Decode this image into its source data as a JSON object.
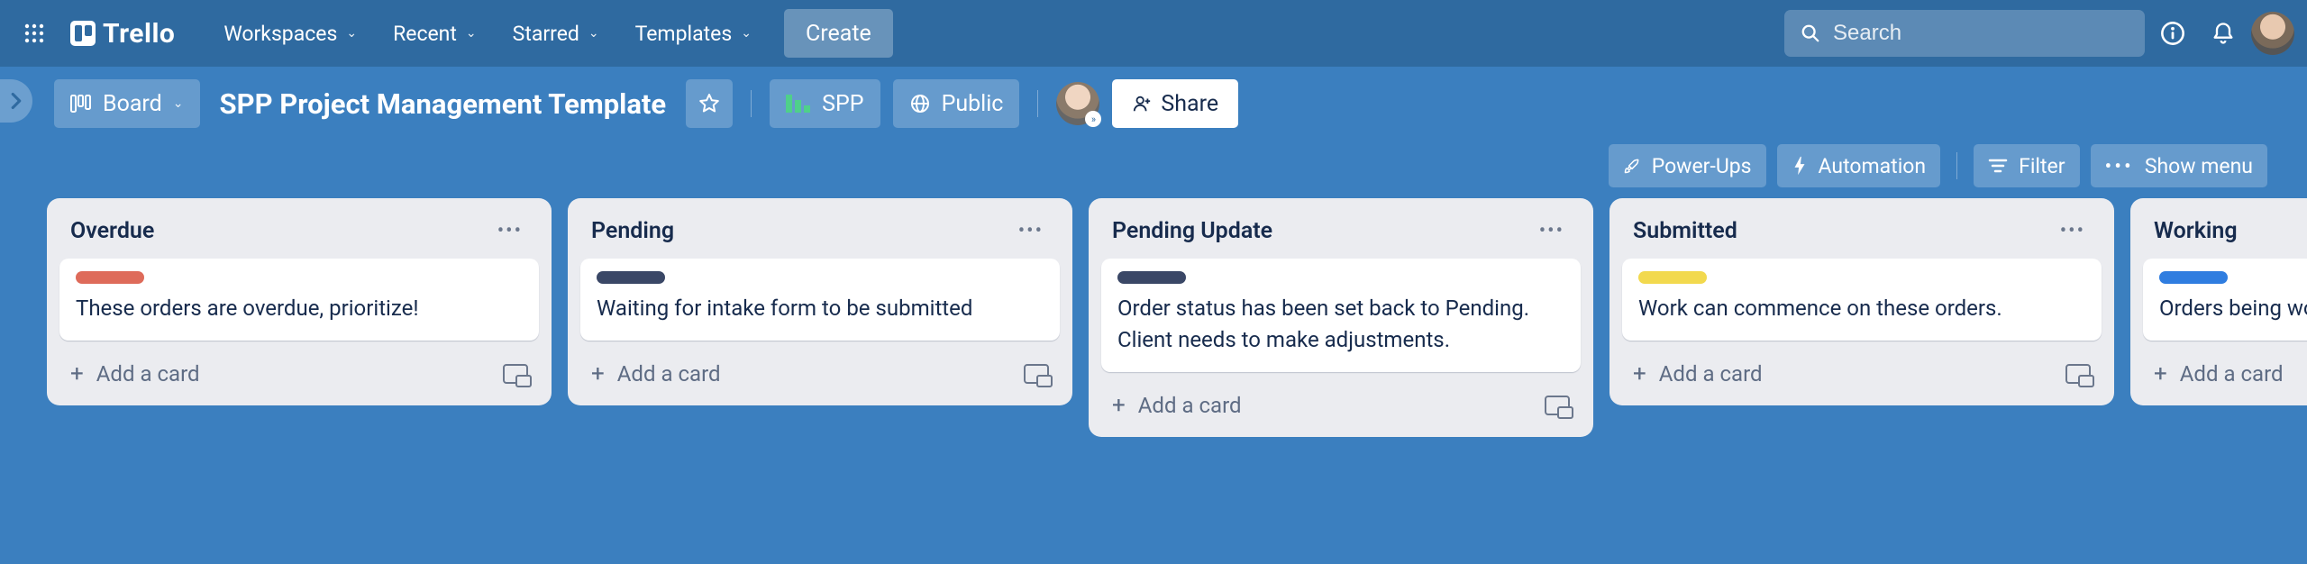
{
  "topnav": {
    "logo_text": "Trello",
    "menus": [
      "Workspaces",
      "Recent",
      "Starred",
      "Templates"
    ],
    "create_label": "Create",
    "search_placeholder": "Search"
  },
  "board_header": {
    "view_label": "Board",
    "title": "SPP Project Management Template",
    "workspace_label": "SPP",
    "visibility_label": "Public",
    "share_label": "Share",
    "powerups_label": "Power-Ups",
    "automation_label": "Automation",
    "filter_label": "Filter",
    "showmenu_label": "Show menu"
  },
  "lists": [
    {
      "title": "Overdue",
      "cards": [
        {
          "label_color": "lbl-red",
          "text": "These orders are overdue, prioritize!"
        }
      ],
      "add_label": "Add a card"
    },
    {
      "title": "Pending",
      "cards": [
        {
          "label_color": "lbl-navy",
          "text": "Waiting for intake form to be submitted"
        }
      ],
      "add_label": "Add a card"
    },
    {
      "title": "Pending Update",
      "cards": [
        {
          "label_color": "lbl-navy",
          "text": "Order status has been set back to Pending. Client needs to make adjustments."
        }
      ],
      "add_label": "Add a card"
    },
    {
      "title": "Submitted",
      "cards": [
        {
          "label_color": "lbl-yellow",
          "text": "Work can commence on these orders."
        }
      ],
      "add_label": "Add a card"
    },
    {
      "title": "Working",
      "cards": [
        {
          "label_color": "lbl-blue",
          "text": "Orders being worked on."
        }
      ],
      "add_label": "Add a card"
    }
  ]
}
